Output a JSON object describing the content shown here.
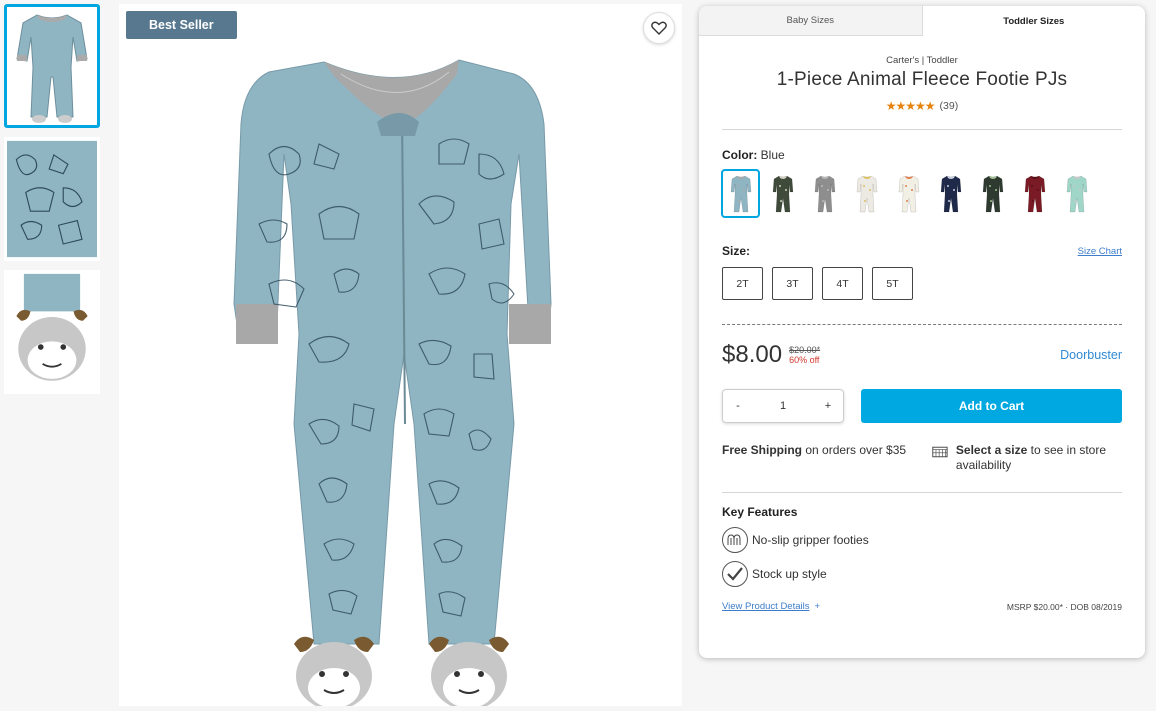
{
  "gallery": {
    "badge": "Best Seller",
    "favorite_icon": "heart-icon"
  },
  "size_tabs": [
    {
      "label": "Baby Sizes",
      "active": false
    },
    {
      "label": "Toddler Sizes",
      "active": true
    }
  ],
  "product": {
    "brand": "Carter's | Toddler",
    "title": "1-Piece Animal Fleece Footie PJs",
    "stars": "★★★★★",
    "rating": 5,
    "review_count": "(39)"
  },
  "color": {
    "label": "Color:",
    "value": "Blue",
    "swatches": [
      {
        "name": "blue",
        "body": "#8fb5c3",
        "accent": "#a9a9a9"
      },
      {
        "name": "dark-camo",
        "body": "#3f4a3a",
        "accent": "#d0d0c0"
      },
      {
        "name": "grey",
        "body": "#8e8e8e",
        "accent": "#b8b8b8"
      },
      {
        "name": "white-print",
        "body": "#eceae2",
        "accent": "#d9c060"
      },
      {
        "name": "ivory-print",
        "body": "#f2efe5",
        "accent": "#e08050"
      },
      {
        "name": "navy",
        "body": "#1f2a4a",
        "accent": "#c8d0e0"
      },
      {
        "name": "dark-green",
        "body": "#2e3a30",
        "accent": "#a0c090"
      },
      {
        "name": "burgundy",
        "body": "#7a1a24",
        "accent": "#5a1018"
      },
      {
        "name": "mint",
        "body": "#9fd6c8",
        "accent": "#c8c8c8"
      }
    ]
  },
  "size": {
    "label": "Size:",
    "chart_link": "Size Chart",
    "options": [
      "2T",
      "3T",
      "4T",
      "5T"
    ]
  },
  "price": {
    "current": "$8.00",
    "original": "$20.00*",
    "discount": "60% off",
    "promo": "Doorbuster"
  },
  "cart": {
    "minus": "-",
    "quantity": "1",
    "plus": "+",
    "add_label": "Add to Cart"
  },
  "shipping": {
    "free_bold": "Free Shipping",
    "free_rest": " on orders over $35",
    "store_bold": "Select a size",
    "store_rest": " to see in store availability"
  },
  "features": {
    "heading": "Key Features",
    "items": [
      {
        "label": "No-slip gripper footies",
        "icon": "gripper-icon"
      },
      {
        "label": "Stock up style",
        "icon": "checkmark-icon"
      }
    ]
  },
  "footer": {
    "details_link": "View Product Details",
    "details_plus": "+",
    "msrp": "MSRP $20.00* · DOB 08/2019"
  }
}
